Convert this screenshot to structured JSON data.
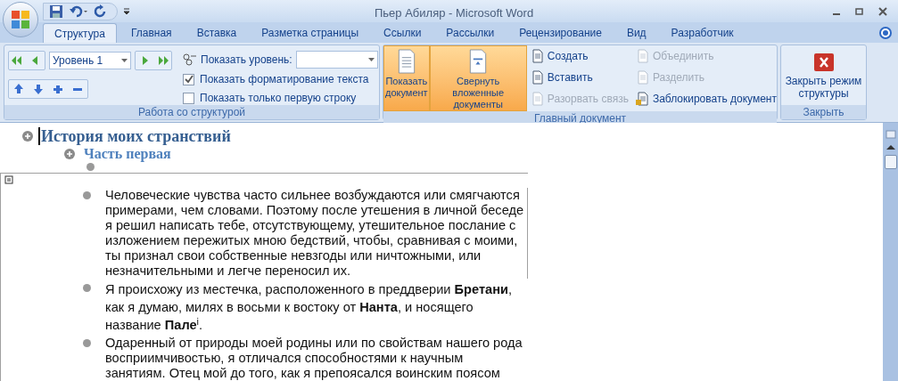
{
  "window": {
    "title": "Пьер Абиляр - Microsoft Word"
  },
  "tabs": [
    {
      "label": "Структура",
      "selected": true
    },
    {
      "label": "Главная",
      "selected": false
    },
    {
      "label": "Вставка",
      "selected": false
    },
    {
      "label": "Разметка страницы",
      "selected": false
    },
    {
      "label": "Ссылки",
      "selected": false
    },
    {
      "label": "Рассылки",
      "selected": false
    },
    {
      "label": "Рецензирование",
      "selected": false
    },
    {
      "label": "Вид",
      "selected": false
    },
    {
      "label": "Разработчик",
      "selected": false
    }
  ],
  "outline_group": {
    "label": "Работа со структурой",
    "level_select": "Уровень 1",
    "show_level_label": "Показать уровень:",
    "options": [
      {
        "label": "Показать форматирование текста",
        "checked": true
      },
      {
        "label": "Показать только первую строку",
        "checked": false
      }
    ]
  },
  "master_group": {
    "label": "Главный документ",
    "big_buttons": [
      {
        "label": "Показать документ",
        "selected": true
      },
      {
        "label": "Свернуть вложенные документы",
        "selected": true
      }
    ],
    "commands": [
      {
        "label": "Создать",
        "disabled": false
      },
      {
        "label": "Вставить",
        "disabled": false
      },
      {
        "label": "Разорвать связь",
        "disabled": true
      },
      {
        "label": "Объединить",
        "disabled": true
      },
      {
        "label": "Разделить",
        "disabled": true
      },
      {
        "label": "Заблокировать документ",
        "disabled": false
      }
    ]
  },
  "close_group": {
    "label": "Закрыть",
    "button": "Закрыть режим структуры"
  },
  "outline": [
    {
      "kind": "heading1",
      "text": "История моих странствий"
    },
    {
      "kind": "heading2",
      "text": "Часть первая"
    },
    {
      "kind": "empty"
    }
  ],
  "subdocument": {
    "paragraphs": [
      {
        "text": "Человеческие чувства часто сильнее возбуждаются или смягчаются примерами, чем словами. Поэтому после утешения в личной беседе я решил написать тебе, отсутствующему, утешительное послание с изложением пережитых мною бедствий, чтобы, сравнивая с моими, ты признал свои собственные невзгоды или ничтожными, или незначительными и легче переносил их."
      },
      {
        "text": "Я происхожу из местечка, расположенного в преддверии **Бретани**, как я думаю, милях в восьми к востоку от **Нанта**, и носящего название **Пале**$^{i}$."
      },
      {
        "text": "Одаренный от природы моей родины или по свойствам нашего рода восприимчивостью, я отличался способностями к научным занятиям. Отец мой до того, как я препоясался воинским поясом"
      }
    ]
  }
}
